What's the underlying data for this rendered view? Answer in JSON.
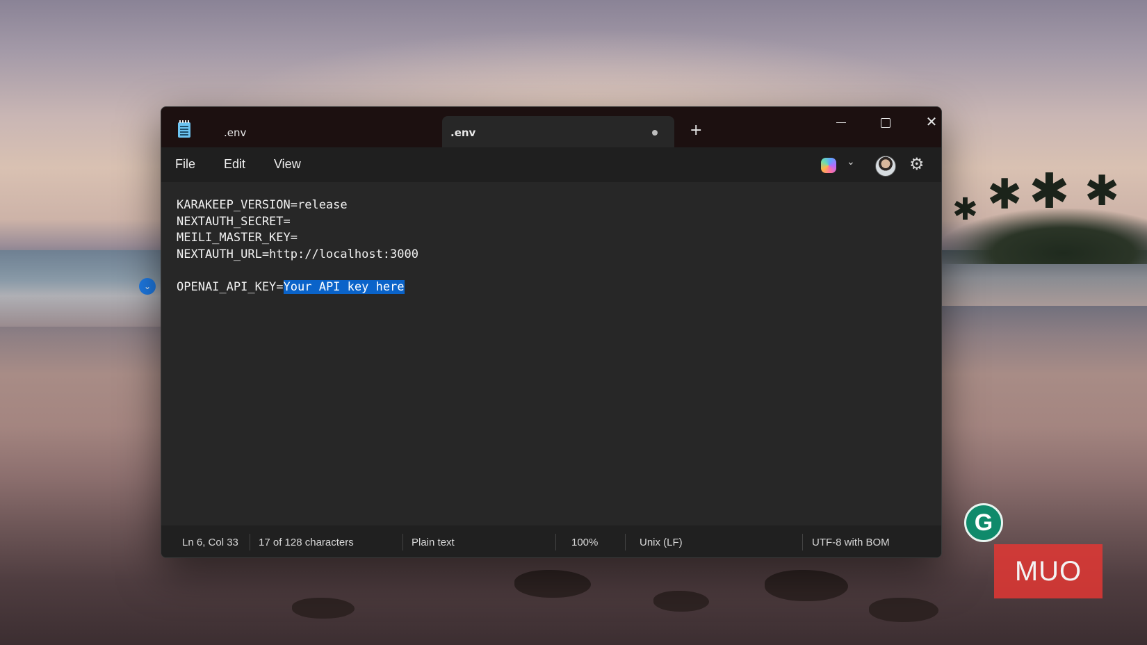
{
  "window": {
    "tabs": [
      {
        "label": ".env",
        "active": false
      },
      {
        "label": ".env",
        "active": true,
        "unsaved": true
      }
    ],
    "new_tab_label": "+",
    "controls": {
      "minimize": "minimize",
      "maximize": "maximize",
      "close": "✕"
    }
  },
  "menu": {
    "file": "File",
    "edit": "Edit",
    "view": "View"
  },
  "toolbar_icons": [
    "copilot-icon",
    "chevron-down-icon",
    "avatar",
    "gear-icon"
  ],
  "editor": {
    "lines": [
      "KARAKEEP_VERSION=release",
      "NEXTAUTH_SECRET=",
      "MEILI_MASTER_KEY=",
      "NEXTAUTH_URL=http://localhost:3000",
      "",
      "OPENAI_API_KEY="
    ],
    "selected_text": "Your API key here",
    "selection_color": "#0a63c9"
  },
  "status": {
    "position": "Ln 6, Col 33",
    "chars": "17 of 128 characters",
    "format": "Plain text",
    "zoom": "100%",
    "line_endings": "Unix (LF)",
    "encoding": "UTF-8 with BOM"
  },
  "overlays": {
    "grammarly_letter": "G",
    "watermark": "MUO",
    "grammarly_color": "#0f8a6b",
    "watermark_color": "#e23734"
  }
}
